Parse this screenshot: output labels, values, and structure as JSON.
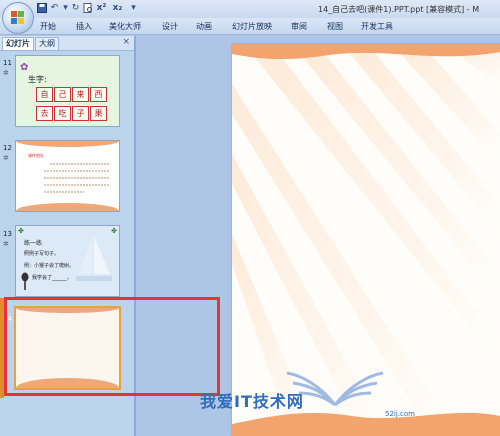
{
  "window": {
    "title": "14_自己去吧(课件1).PPT.ppt [兼容模式] - M"
  },
  "quick_access": [
    "save-icon",
    "undo-icon",
    "redo-icon",
    "print-preview-icon",
    "superscript-icon",
    "subscript-icon",
    "customize-icon"
  ],
  "ribbon": {
    "tabs": [
      "开始",
      "插入",
      "美化大师",
      "设计",
      "动画",
      "幻灯片放映",
      "审阅",
      "视图",
      "开发工具"
    ]
  },
  "panel": {
    "tabs": [
      "幻灯片",
      "大纲"
    ],
    "close": "×"
  },
  "slides": [
    {
      "number": "11",
      "title": "生字:",
      "rows": [
        [
          "自",
          "己",
          "来",
          "西"
        ],
        [
          "去",
          "吃",
          "子",
          "果"
        ]
      ]
    },
    {
      "number": "12",
      "heading": "课件地址"
    },
    {
      "number": "13",
      "lines": [
        "练一练",
        "照例子写句子。",
        "例：小猴子会了爬树。",
        "我学会了______。"
      ]
    },
    {
      "number": "14"
    }
  ],
  "watermark": {
    "text": "我爱IT技术网",
    "url": "52ij.com"
  },
  "colors": {
    "highlight": "#e5323a",
    "slide_accent": "#f0a878",
    "selected_border": "#e5a33d"
  }
}
